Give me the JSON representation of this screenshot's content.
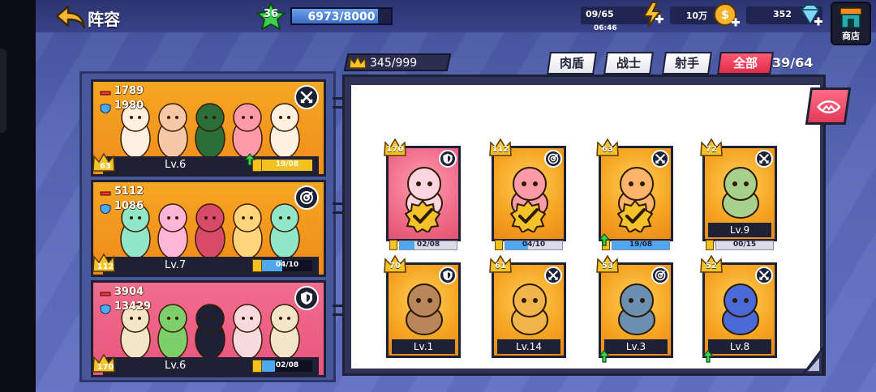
{
  "header": {
    "title": "阵容",
    "player_level": "36",
    "exp_text": "6973/8000",
    "exp_progress": 0.87,
    "stamina": "09/65",
    "stamina_timer": "06:46",
    "gold": "10万",
    "gems": "352",
    "shop_label": "商店"
  },
  "teams": [
    {
      "attack": "1789",
      "defense": "1980",
      "class_icon": "swords-icon",
      "count": "63",
      "level": "Lv.6",
      "shard_text": "19/08",
      "shard_progress": 1.0,
      "shard_color": "#f3c21e",
      "upgrade": true
    },
    {
      "attack": "5112",
      "defense": "1086",
      "class_icon": "target-icon",
      "count": "112",
      "level": "Lv.7",
      "shard_text": "04/10",
      "shard_progress": 0.4,
      "shard_color": "#4ea8f0",
      "upgrade": false
    },
    {
      "attack": "3904",
      "defense": "13429",
      "class_icon": "shield-icon",
      "count": "170",
      "level": "Lv.6",
      "shard_text": "02/08",
      "shard_progress": 0.25,
      "shard_color": "#4ea8f0",
      "upgrade": false
    }
  ],
  "roster": {
    "capacity": "345/999",
    "tabs": {
      "tank": "肉盾",
      "warrior": "战士",
      "archer": "射手",
      "all": "全部"
    },
    "count": "39/64",
    "heroes": [
      {
        "count": "170",
        "class_icon": "shield-icon",
        "level": "",
        "shard_text": "02/08",
        "shard_progress": 0.25,
        "in_team": true,
        "upgrade": false,
        "color": "pink"
      },
      {
        "count": "112",
        "class_icon": "target-icon",
        "level": "",
        "shard_text": "04/10",
        "shard_progress": 0.4,
        "in_team": true,
        "upgrade": false,
        "color": "orange"
      },
      {
        "count": "63",
        "class_icon": "swords-icon",
        "level": "",
        "shard_text": "19/08",
        "shard_progress": 1.0,
        "in_team": true,
        "upgrade": true,
        "color": "orange"
      },
      {
        "count": "72",
        "class_icon": "swords-icon",
        "level": "Lv.9",
        "shard_text": "00/15",
        "shard_progress": 0.0,
        "in_team": false,
        "upgrade": false,
        "color": "orange"
      },
      {
        "count": "70",
        "class_icon": "shield-icon",
        "level": "Lv.1",
        "shard_text": "",
        "shard_progress": 0.0,
        "in_team": false,
        "upgrade": false,
        "color": "orange"
      },
      {
        "count": "61",
        "class_icon": "swords-icon",
        "level": "Lv.14",
        "shard_text": "",
        "shard_progress": 0.0,
        "in_team": false,
        "upgrade": false,
        "color": "orange"
      },
      {
        "count": "53",
        "class_icon": "target-icon",
        "level": "Lv.3",
        "shard_text": "",
        "shard_progress": 0.0,
        "in_team": false,
        "upgrade": true,
        "color": "orange"
      },
      {
        "count": "52",
        "class_icon": "swords-icon",
        "level": "Lv.8",
        "shard_text": "",
        "shard_progress": 0.0,
        "in_team": false,
        "upgrade": true,
        "color": "orange"
      }
    ]
  },
  "colors": {
    "accent_pink": "#e02a4a",
    "panel_blue": "#48579c",
    "card_orange": "#f6a523",
    "exp_blue": "#3a6fc4"
  }
}
